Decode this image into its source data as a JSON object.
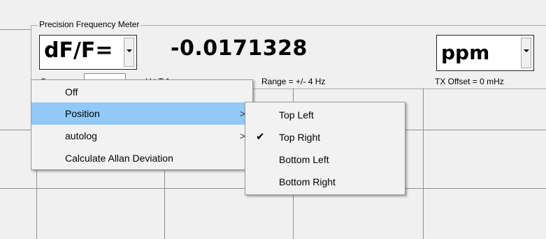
{
  "group": {
    "title": "Precision Frequency Meter"
  },
  "mode_combo": {
    "value": "dF/F="
  },
  "reading": {
    "value": "-0.0171328"
  },
  "unit_combo": {
    "value": "ppm"
  },
  "info": {
    "sample_label_partial": "S",
    "gate_text_partial": "U          t T       1 s",
    "range": "Range = +/- 4 Hz",
    "tx_offset": "TX Offset = 0 mHz"
  },
  "context_menu": {
    "items": [
      {
        "label": "Off",
        "has_submenu": false
      },
      {
        "label": "Position",
        "has_submenu": true,
        "highlighted": true
      },
      {
        "label": "autolog",
        "has_submenu": true
      },
      {
        "label": "Calculate Allan Deviation",
        "has_submenu": false
      }
    ],
    "submenu_arrow": ">"
  },
  "position_submenu": {
    "items": [
      {
        "label": "Top Left",
        "checked": false
      },
      {
        "label": "Top Right",
        "checked": true
      },
      {
        "label": "Bottom Left",
        "checked": false
      },
      {
        "label": "Bottom Right",
        "checked": false
      }
    ],
    "check_glyph": "✔"
  }
}
